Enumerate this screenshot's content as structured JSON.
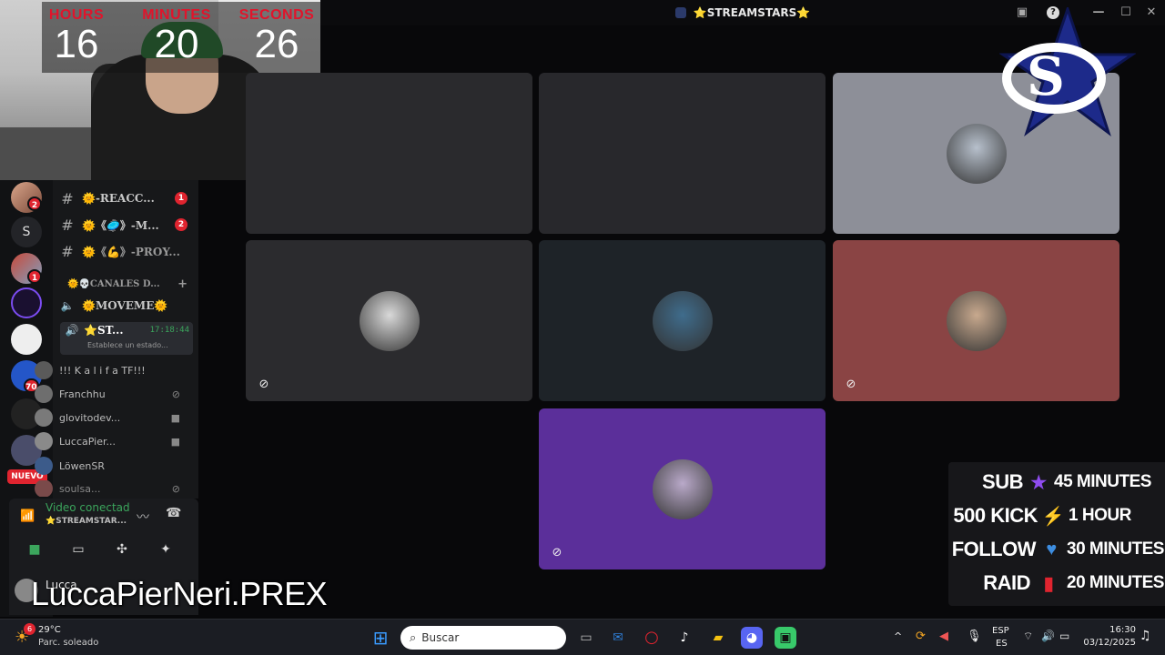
{
  "window": {
    "title": "⭐STREAMSTARS⭐"
  },
  "timer": {
    "hours_label": "HOURS",
    "minutes_label": "MINUTES",
    "seconds_label": "SECONDS",
    "hours": "16",
    "minutes": "20",
    "seconds": "26"
  },
  "rail": {
    "badges": [
      "2",
      "1",
      "70"
    ],
    "letter_server": "S",
    "nuevo": "NUEVO"
  },
  "channels": {
    "text": [
      {
        "name": "🌞-REACC...",
        "count": "1"
      },
      {
        "name": "🌞《🥏》-M...",
        "count": "2"
      },
      {
        "name": "🌞《💪》-PROY...",
        "count": ""
      }
    ],
    "category": "🌞💀CANALES D...",
    "voice": [
      {
        "name": "🌞MOVEME🌞"
      },
      {
        "name": "⭐ST...",
        "time": "17:18:44",
        "status": "Establece un estado..."
      }
    ],
    "users": [
      {
        "name": "!!! K a l i f a TF!!!",
        "icon": "",
        "color": "#5a5a5a"
      },
      {
        "name": "Franchhu",
        "icon": "mic-off-icon",
        "color": "#6e6e6e"
      },
      {
        "name": "glovitodev...",
        "icon": "camera-icon",
        "color": "#7a7a7a"
      },
      {
        "name": "LuccaPier...",
        "icon": "camera-icon",
        "color": "#8a8a8a"
      },
      {
        "name": "LöwenSR",
        "icon": "",
        "color": "#3c5b8a"
      },
      {
        "name": "soulsa...",
        "icon": "mic-off-icon",
        "color": "#7a4a4a"
      }
    ]
  },
  "voice_panel": {
    "status": "Video conectad",
    "channel": "⭐STREAMSTAR..."
  },
  "user": {
    "name": "Lucca",
    "overlay_name": "LuccaPierNeri.PREX"
  },
  "tiles": [
    {
      "bg": "#2a2a2d",
      "avatar": false,
      "muted": false
    },
    {
      "bg": "#28282c",
      "avatar": false,
      "muted": false
    },
    {
      "bg": "#8d8f98",
      "avatar": true,
      "avatar_color": "#b7c0cc",
      "muted": false
    },
    {
      "bg": "#2b2b2e",
      "avatar": true,
      "avatar_color": "#d9d9d9",
      "muted": true
    },
    {
      "bg": "#1e2328",
      "avatar": true,
      "avatar_color": "#3f6c8c",
      "muted": false
    },
    {
      "bg": "#8a4444",
      "avatar": true,
      "avatar_color": "#c8a98e",
      "muted": true
    },
    {
      "bg": "#5b2f9a",
      "avatar": true,
      "avatar_color": "#b9a9c9",
      "muted": true
    }
  ],
  "sub_panel": [
    {
      "label": "SUB",
      "icon": "★",
      "icon_color": "#8f4cf0",
      "value": "45 MINUTES"
    },
    {
      "label": "500 KICK",
      "icon": "⚡",
      "icon_color": "#f5c211",
      "value": "1 HOUR"
    },
    {
      "label": "FOLLOW",
      "icon": "♥",
      "icon_color": "#3d8de0",
      "value": "30 MINUTES"
    },
    {
      "label": "RAID",
      "icon": "▮",
      "icon_color": "#e0242f",
      "value": "20 MINUTES"
    }
  ],
  "taskbar": {
    "weather_temp": "29°C",
    "weather_desc": "Parc. soleado",
    "weather_badge": "6",
    "search_placeholder": "Buscar",
    "lang1": "ESP",
    "lang2": "ES",
    "time": "16:30",
    "date": "03/12/2025"
  }
}
